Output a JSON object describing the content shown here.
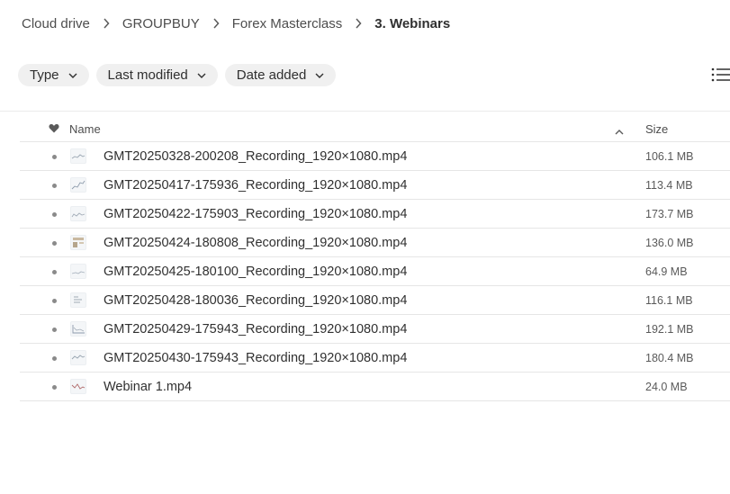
{
  "breadcrumb": {
    "items": [
      "Cloud drive",
      "GROUPBUY",
      "Forex Masterclass"
    ],
    "current": "3. Webinars"
  },
  "filters": {
    "type_label": "Type",
    "last_modified_label": "Last modified",
    "date_added_label": "Date added"
  },
  "table": {
    "headers": {
      "name": "Name",
      "size": "Size"
    },
    "rows": [
      {
        "name": "GMT20250328-200208_Recording_1920×1080.mp4",
        "size": "106.1 MB",
        "icon": "video-thumbnail"
      },
      {
        "name": "GMT20250417-175936_Recording_1920×1080.mp4",
        "size": "113.4 MB",
        "icon": "video-thumbnail"
      },
      {
        "name": "GMT20250422-175903_Recording_1920×1080.mp4",
        "size": "173.7 MB",
        "icon": "video-thumbnail"
      },
      {
        "name": "GMT20250424-180808_Recording_1920×1080.mp4",
        "size": "136.0 MB",
        "icon": "video-thumbnail"
      },
      {
        "name": "GMT20250425-180100_Recording_1920×1080.mp4",
        "size": "64.9 MB",
        "icon": "video-thumbnail"
      },
      {
        "name": "GMT20250428-180036_Recording_1920×1080.mp4",
        "size": "116.1 MB",
        "icon": "video-thumbnail"
      },
      {
        "name": "GMT20250429-175943_Recording_1920×1080.mp4",
        "size": "192.1 MB",
        "icon": "video-thumbnail"
      },
      {
        "name": "GMT20250430-175943_Recording_1920×1080.mp4",
        "size": "180.4 MB",
        "icon": "video-thumbnail"
      },
      {
        "name": "Webinar 1.mp4",
        "size": "24.0 MB",
        "icon": "video-thumbnail"
      }
    ]
  },
  "colors": {
    "chip_background": "#f0f0f0",
    "divider": "#e6e6e6",
    "text": "#303030"
  }
}
